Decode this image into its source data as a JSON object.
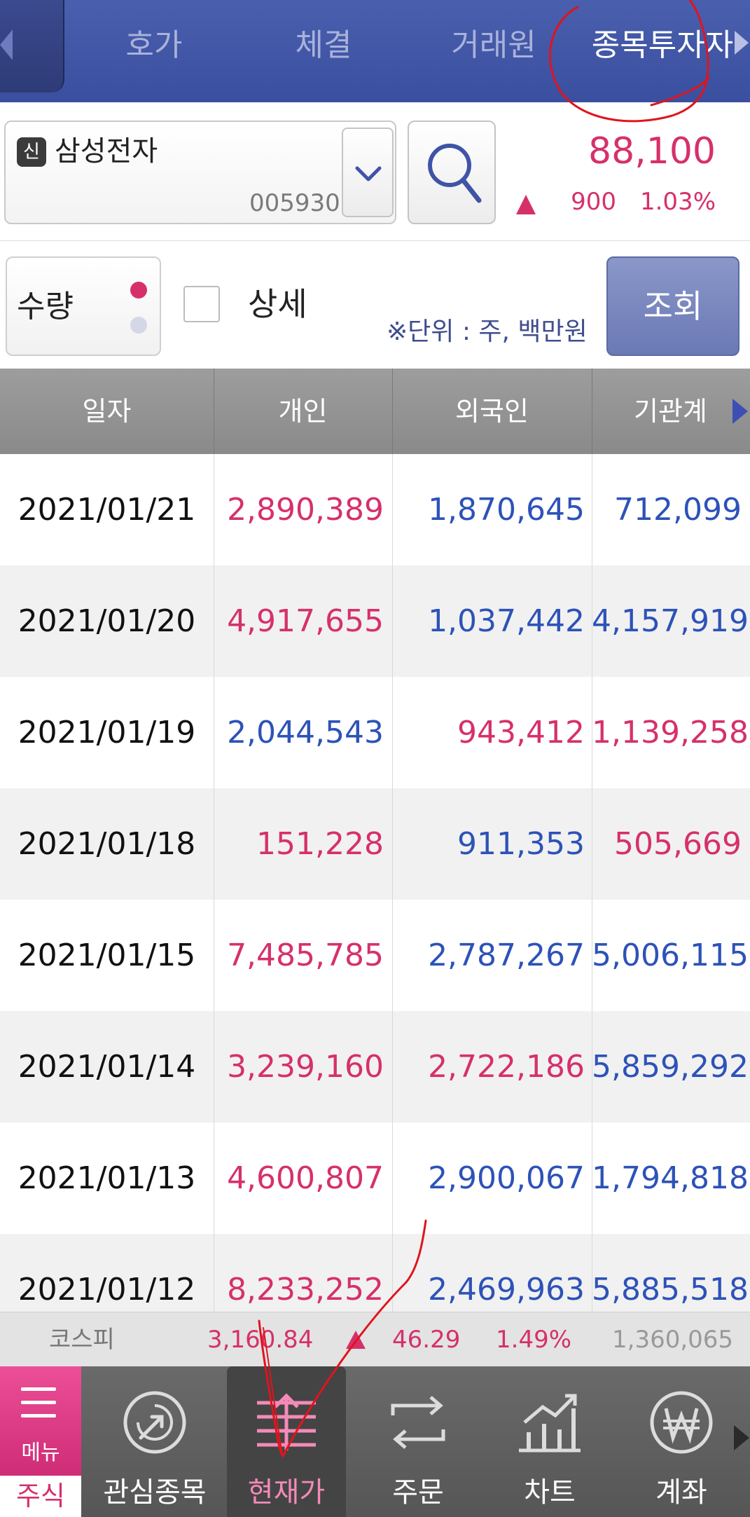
{
  "tabs": [
    {
      "label": "호가"
    },
    {
      "label": "체결"
    },
    {
      "label": "거래원"
    },
    {
      "label": "종목투자자",
      "active": true
    }
  ],
  "stock": {
    "badge": "신",
    "name": "삼성전자",
    "code": "005930",
    "price": "88,100",
    "change": "900",
    "change_pct": "1.03%",
    "direction": "up"
  },
  "options": {
    "mode_label": "수량",
    "detail_label": "상세",
    "detail_checked": false,
    "unit_note": "※단위 : 주, 백만원",
    "query_label": "조회"
  },
  "table": {
    "headers": [
      "일자",
      "개인",
      "외국인",
      "기관계"
    ],
    "rows": [
      {
        "date": "2021/01/21",
        "individual": "2,890,389",
        "foreign": "1,870,645",
        "institution": "712,099"
      },
      {
        "date": "2021/01/20",
        "individual": "4,917,655",
        "foreign": "1,037,442",
        "institution": "4,157,919"
      },
      {
        "date": "2021/01/19",
        "individual": "2,044,543",
        "foreign": "943,412",
        "institution": "1,139,258"
      },
      {
        "date": "2021/01/18",
        "individual": "151,228",
        "foreign": "911,353",
        "institution": "505,669"
      },
      {
        "date": "2021/01/15",
        "individual": "7,485,785",
        "foreign": "2,787,267",
        "institution": "5,006,115"
      },
      {
        "date": "2021/01/14",
        "individual": "3,239,160",
        "foreign": "2,722,186",
        "institution": "5,859,292"
      },
      {
        "date": "2021/01/13",
        "individual": "4,600,807",
        "foreign": "2,900,067",
        "institution": "1,794,818"
      },
      {
        "date": "2021/01/12",
        "individual": "8,233,252",
        "foreign": "2,469,963",
        "institution": "5,885,518"
      }
    ]
  },
  "index": {
    "name": "코스피",
    "value": "3,160.84",
    "change": "46.29",
    "change_pct": "1.49%",
    "volume": "1,360,065"
  },
  "nav": {
    "menu_label": "메뉴",
    "stock_label": "주식",
    "items": [
      {
        "label": "관심종목",
        "icon": "watchlist-icon"
      },
      {
        "label": "현재가",
        "icon": "current-price-icon",
        "selected": true
      },
      {
        "label": "주문",
        "icon": "order-icon"
      },
      {
        "label": "차트",
        "icon": "chart-icon"
      },
      {
        "label": "계좌",
        "icon": "account-won-icon"
      }
    ]
  },
  "colors": {
    "header_blue": "#3f54a6",
    "up_pink": "#d6306b",
    "down_blue": "#2d52b8",
    "menu_pink": "#e0418a"
  }
}
